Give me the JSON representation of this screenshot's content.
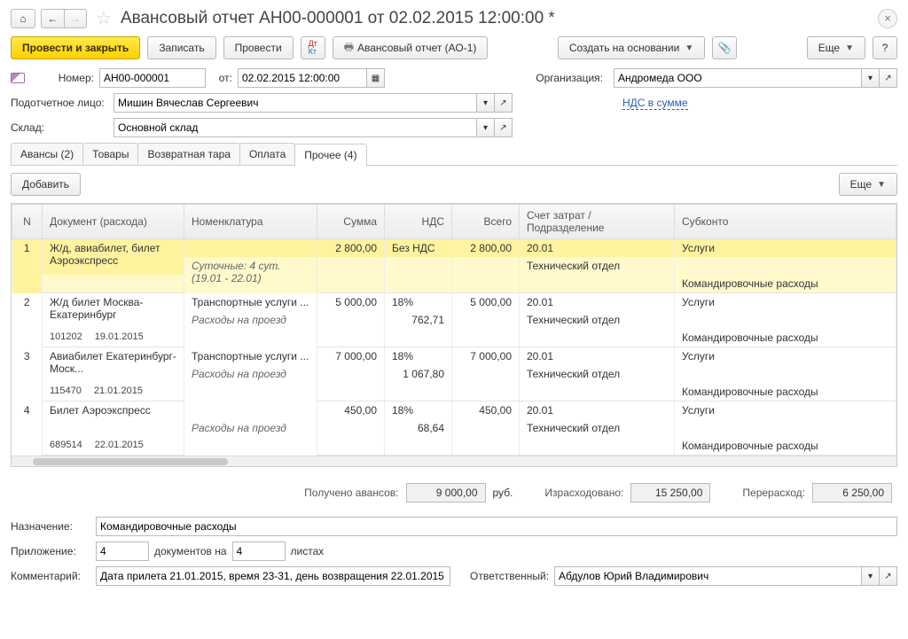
{
  "title": "Авансовый отчет АН00-000001 от 02.02.2015 12:00:00 *",
  "toolbar": {
    "submit_close": "Провести и закрыть",
    "save": "Записать",
    "post": "Провести",
    "print": "Авансовый отчет (АО-1)",
    "create_based": "Создать на основании",
    "more": "Еще",
    "help": "?"
  },
  "fields": {
    "number_label": "Номер:",
    "number": "АН00-000001",
    "from_label": "от:",
    "date": "02.02.2015 12:00:00",
    "org_label": "Организация:",
    "org": "Андромеда ООО",
    "person_label": "Подотчетное лицо:",
    "person": "Мишин Вячеслав Сергеевич",
    "nds_link": "НДС в сумме",
    "warehouse_label": "Склад:",
    "warehouse": "Основной склад"
  },
  "tabs": {
    "t1": "Авансы (2)",
    "t2": "Товары",
    "t3": "Возвратная тара",
    "t4": "Оплата",
    "t5": "Прочее (4)"
  },
  "subtb": {
    "add": "Добавить",
    "more": "Еще"
  },
  "cols": {
    "n": "N",
    "doc": "Документ (расхода)",
    "nomen": "Номенклатура",
    "sum": "Сумма",
    "nds": "НДС",
    "total": "Всего",
    "acct": "Счет затрат / Подразделение",
    "sub": "Субконто"
  },
  "rows": [
    {
      "n": "1",
      "doc1": "Ж/д, авиабилет, билет Аэроэкспресс",
      "doc2a": "",
      "doc2b": "",
      "nomen1": "",
      "nomen2": "Суточные: 4 сут. (19.01 - 22.01)",
      "sum": "2 800,00",
      "nds1": "Без НДС",
      "nds2": "",
      "total": "2 800,00",
      "acct1": "20.01",
      "acct2": "Технический отдел",
      "sub1": "Услуги",
      "sub2": "Командировочные расходы",
      "highlight": true
    },
    {
      "n": "2",
      "doc1": "Ж/д билет Москва-Екатеринбург",
      "doc2a": "101202",
      "doc2b": "19.01.2015",
      "nomen1": "Транспортные услуги ...",
      "nomen2": "Расходы на проезд",
      "sum": "5 000,00",
      "nds1": "18%",
      "nds2": "762,71",
      "total": "5 000,00",
      "acct1": "20.01",
      "acct2": "Технический отдел",
      "sub1": "Услуги",
      "sub2": "Командировочные расходы"
    },
    {
      "n": "3",
      "doc1": "Авиабилет Екатеринбург-Моск...",
      "doc2a": "115470",
      "doc2b": "21.01.2015",
      "nomen1": "Транспортные услуги ...",
      "nomen2": "Расходы на проезд",
      "sum": "7 000,00",
      "nds1": "18%",
      "nds2": "1 067,80",
      "total": "7 000,00",
      "acct1": "20.01",
      "acct2": "Технический отдел",
      "sub1": "Услуги",
      "sub2": "Командировочные расходы"
    },
    {
      "n": "4",
      "doc1": "Билет Аэроэкспресс",
      "doc2a": "689514",
      "doc2b": "22.01.2015",
      "nomen1": "",
      "nomen2": "Расходы на проезд",
      "sum": "450,00",
      "nds1": "18%",
      "nds2": "68,64",
      "total": "450,00",
      "acct1": "20.01",
      "acct2": "Технический отдел",
      "sub1": "Услуги",
      "sub2": "Командировочные расходы"
    }
  ],
  "totals": {
    "received_label": "Получено авансов:",
    "received": "9 000,00",
    "currency": "руб.",
    "spent_label": "Израсходовано:",
    "spent": "15 250,00",
    "over_label": "Перерасход:",
    "over": "6 250,00"
  },
  "footer": {
    "purpose_label": "Назначение:",
    "purpose": "Командировочные расходы",
    "attach_label": "Приложение:",
    "attach1": "4",
    "docs_on": "документов на",
    "attach2": "4",
    "sheets": "листах",
    "comment_label": "Комментарий:",
    "comment": "Дата прилета 21.01.2015, время 23-31, день возвращения 22.01.2015",
    "resp_label": "Ответственный:",
    "resp": "Абдулов Юрий Владимирович"
  }
}
